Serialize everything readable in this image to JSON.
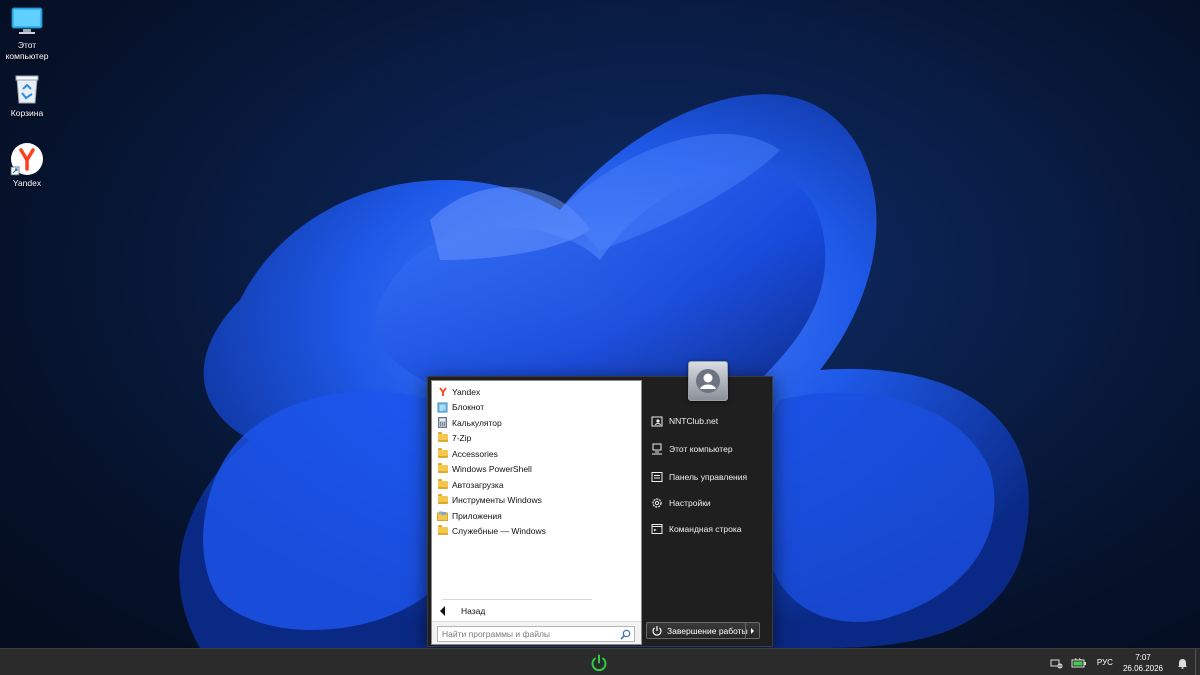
{
  "desktop": {
    "icons": [
      {
        "label": "Этот компьютер",
        "icon": "monitor-icon"
      },
      {
        "label": "Корзина",
        "icon": "recycle-bin-icon"
      },
      {
        "label": "Yandex",
        "icon": "yandex-icon"
      }
    ]
  },
  "start_menu": {
    "programs": [
      {
        "label": "Yandex",
        "icon": "yandex-icon"
      },
      {
        "label": "Блокнот",
        "icon": "notepad-icon"
      },
      {
        "label": "Калькулятор",
        "icon": "calculator-icon"
      },
      {
        "label": "7-Zip",
        "icon": "folder-icon"
      },
      {
        "label": "Accessories",
        "icon": "folder-icon"
      },
      {
        "label": "Windows PowerShell",
        "icon": "folder-icon"
      },
      {
        "label": "Автозагрузка",
        "icon": "folder-icon"
      },
      {
        "label": "Инструменты Windows",
        "icon": "folder-icon"
      },
      {
        "label": "Приложения",
        "icon": "apps-folder-icon"
      },
      {
        "label": "Служебные — Windows",
        "icon": "folder-icon"
      }
    ],
    "back_label": "Назад",
    "search_placeholder": "Найти программы и файлы",
    "right_items": [
      {
        "label": "NNTClub.net",
        "icon": "user-folder-icon"
      },
      {
        "label": "Этот компьютер",
        "icon": "computer-icon"
      },
      {
        "label": "Панель управления",
        "icon": "control-panel-icon"
      },
      {
        "label": "Настройки",
        "icon": "gear-icon"
      },
      {
        "label": "Командная строка",
        "icon": "terminal-icon"
      }
    ],
    "shutdown_label": "Завершение работы"
  },
  "taskbar": {
    "language": "РУС",
    "time": "7:07",
    "date": "26.06.2026"
  },
  "colors": {
    "accent": "#1e5bff",
    "taskbar": "#2b2b2b",
    "start_button": "#2ecc40"
  }
}
